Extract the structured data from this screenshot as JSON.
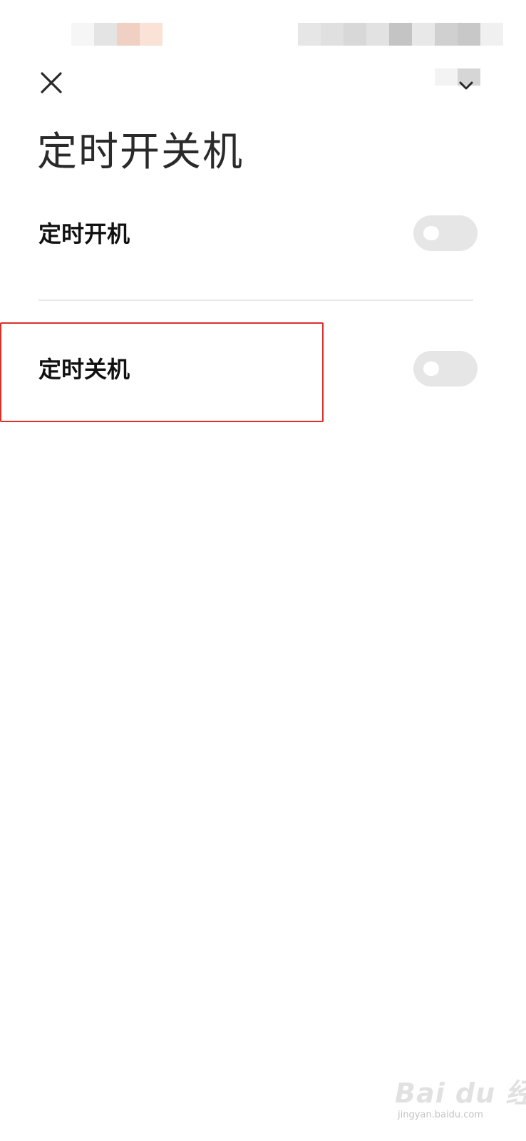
{
  "status_bar": {
    "left_pixels": [
      "#f6f6f6",
      "#e4e4e4",
      "#f0d0c2",
      "#fae2d7"
    ],
    "right_pixels": [
      "#e6e6e6",
      "#e0e0e0",
      "#d8d8d8",
      "#e2e2e2",
      "#c4c4c4",
      "#e8e8e8",
      "#d0d0d0",
      "#c8c8c8",
      "#f0f0f0"
    ]
  },
  "header": {
    "close_icon": "close-icon",
    "dropdown_icon": "chevron-down-icon",
    "title": "定时开关机"
  },
  "settings": [
    {
      "label": "定时开机",
      "enabled": false
    },
    {
      "label": "定时关机",
      "enabled": false
    }
  ],
  "colors": {
    "toggle_off_track": "#e6e6e6",
    "highlight_border": "#d9302a",
    "divider": "#e8e8e8"
  },
  "watermark": {
    "text": "Bai du 经验",
    "sub": "jingyan.baidu.com"
  }
}
